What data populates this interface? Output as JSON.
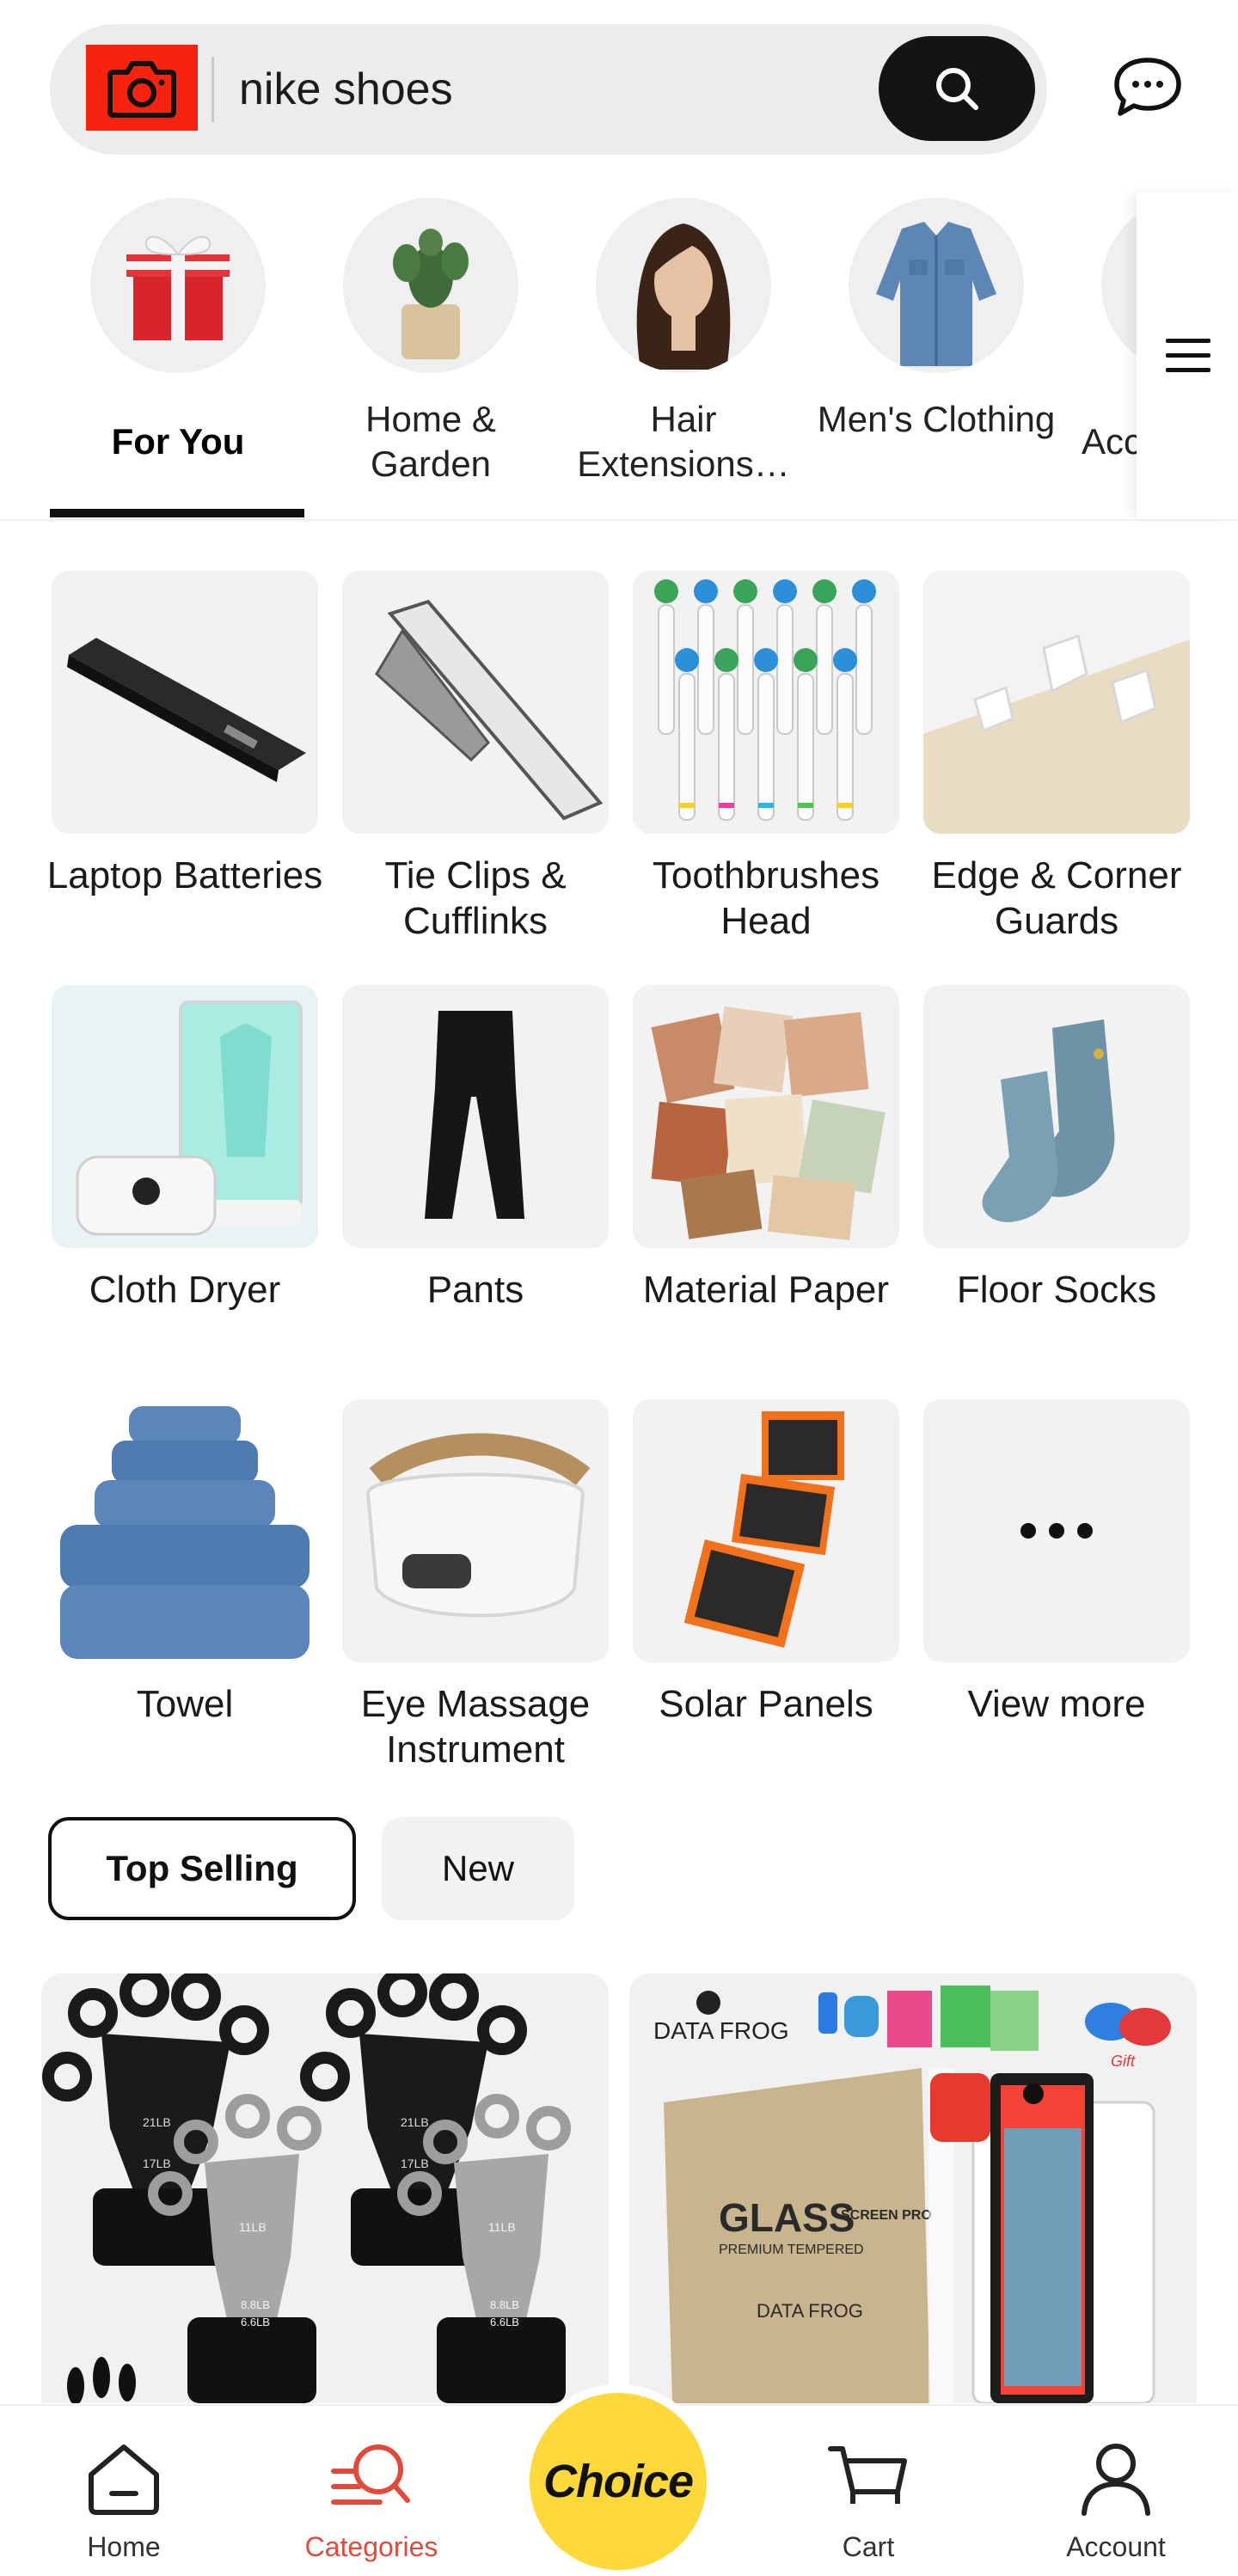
{
  "search": {
    "query": "nike shoes",
    "icons": {
      "camera": "camera-icon",
      "search": "search-icon",
      "messages": "chat-bubble-icon"
    }
  },
  "category_tabs": [
    {
      "label": "For You",
      "active": true,
      "icon": "gift-box-icon"
    },
    {
      "label": "Home & Garden",
      "active": false,
      "icon": "potted-cactus-icon"
    },
    {
      "label": "Hair Extensions…",
      "active": false,
      "icon": "woman-hair-icon"
    },
    {
      "label": "Men's Clothing",
      "active": false,
      "icon": "denim-shirt-icon"
    },
    {
      "label": "Acc",
      "active": false,
      "icon": "sunglasses-icon"
    }
  ],
  "menu_icon": "hamburger-menu-icon",
  "categories": [
    {
      "label": "Laptop Batteries",
      "icon": "laptop-battery-icon"
    },
    {
      "label": "Tie Clips & Cufflinks",
      "icon": "tie-clip-icon"
    },
    {
      "label": "Toothbrushes Head",
      "icon": "toothbrush-heads-icon"
    },
    {
      "label": "Edge & Corner Guards",
      "icon": "corner-guard-icon"
    },
    {
      "label": "Cloth Dryer",
      "icon": "cloth-dryer-icon"
    },
    {
      "label": "Pants",
      "icon": "pants-icon"
    },
    {
      "label": "Material Paper",
      "icon": "material-paper-icon"
    },
    {
      "label": "Floor Socks",
      "icon": "socks-icon"
    },
    {
      "label": "Towel",
      "icon": "towel-icon"
    },
    {
      "label": "Eye Massage Instrument",
      "icon": "eye-massager-icon"
    },
    {
      "label": "Solar Panels",
      "icon": "solar-panel-icon"
    },
    {
      "label": "View more",
      "icon": "more-dots-icon"
    }
  ],
  "filters": {
    "top_selling": "Top Selling",
    "new": "New",
    "active": "Top Selling"
  },
  "products": [
    {
      "icon": "hand-grip-trainer-icon",
      "labels": [
        "21LB",
        "17LB",
        "11LB",
        "8.8LB",
        "6.6LB"
      ]
    },
    {
      "icon": "screen-protector-icon",
      "brand": "DATA FROG",
      "box_text": "GLASS",
      "box_text_2": "SCREEN PRO",
      "box_text_3": "PREMIUM TEMPERED",
      "badge": "Gift"
    }
  ],
  "bottom_nav": {
    "home": "Home",
    "categories": "Categories",
    "choice": "Choice",
    "cart": "Cart",
    "account": "Account",
    "active": "Categories"
  },
  "colors": {
    "accent_red": "#f5230f",
    "nav_active": "#e24b3b",
    "choice_yellow": "#ffd83a",
    "tile_bg": "#f2f2f2",
    "search_bg": "#ececec"
  }
}
